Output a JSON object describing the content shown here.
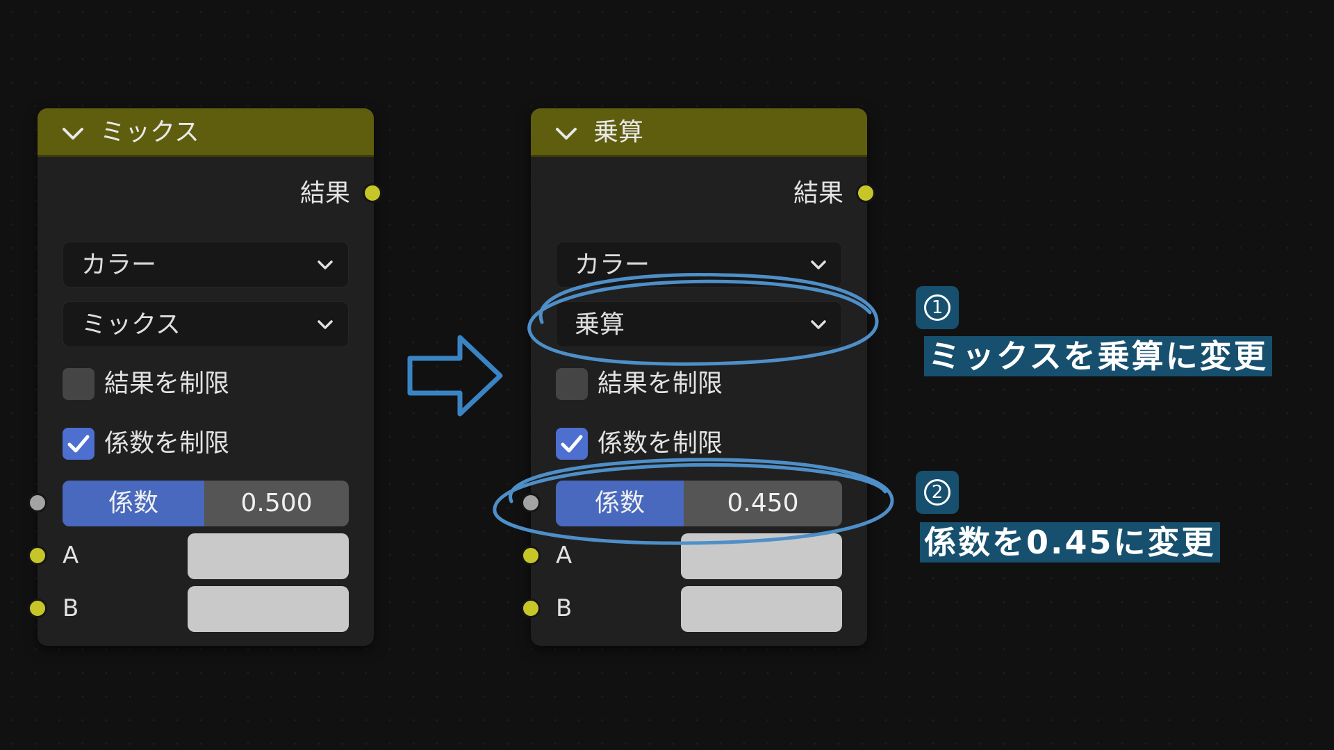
{
  "left_node": {
    "title": "ミックス",
    "output_label": "結果",
    "data_type": "カラー",
    "blend_mode": "ミックス",
    "clamp_result_label": "結果を制限",
    "clamp_result_checked": false,
    "clamp_factor_label": "係数を制限",
    "clamp_factor_checked": true,
    "factor_label": "係数",
    "factor_value": "0.500",
    "input_a_label": "A",
    "input_b_label": "B"
  },
  "right_node": {
    "title": "乗算",
    "output_label": "結果",
    "data_type": "カラー",
    "blend_mode": "乗算",
    "clamp_result_label": "結果を制限",
    "clamp_result_checked": false,
    "clamp_factor_label": "係数を制限",
    "clamp_factor_checked": true,
    "factor_label": "係数",
    "factor_value": "0.450",
    "input_a_label": "A",
    "input_b_label": "B"
  },
  "annotations": [
    {
      "number": "1",
      "text": "ミックスを乗算に変更"
    },
    {
      "number": "2",
      "text": "係数を0.45に変更"
    }
  ],
  "colors": {
    "header": "#5f5e0f",
    "socket_yellow": "#c7c629",
    "socket_gray": "#a3a3a3",
    "slider_fill": "#4869bd",
    "checkbox_checked": "#4c6fd0",
    "annotation_bg": "#17506e",
    "highlight_stroke": "#4e8fc8"
  }
}
